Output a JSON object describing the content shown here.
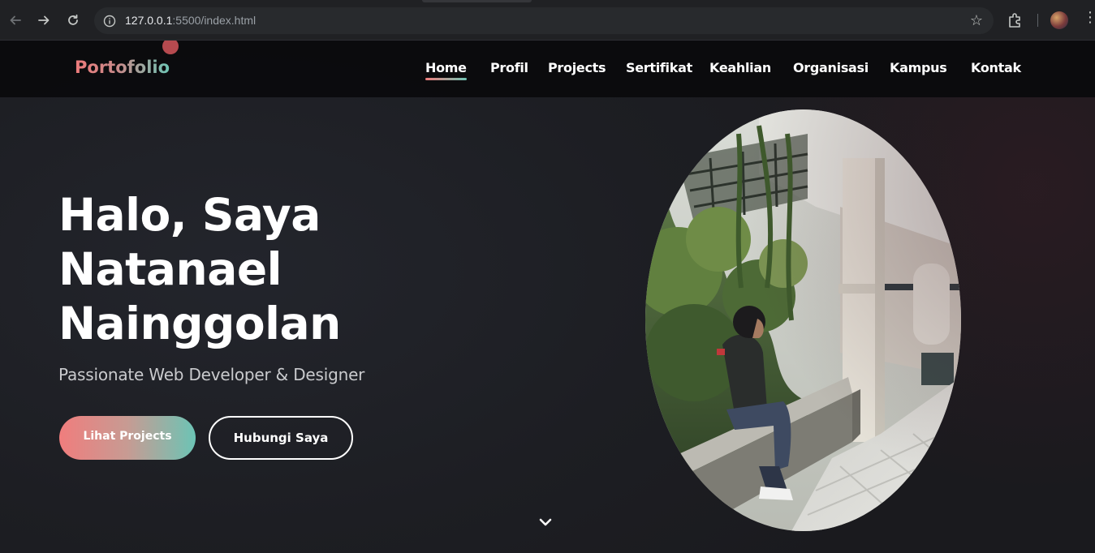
{
  "browser": {
    "url_host": "127.0.0.1",
    "url_path": ":5500/index.html"
  },
  "navbar": {
    "logo": "Portofolio",
    "items": [
      {
        "label": "Home",
        "active": true
      },
      {
        "label": "Profil"
      },
      {
        "label": "Projects"
      },
      {
        "label": "Sertifikat"
      },
      {
        "label": "Keahlian"
      },
      {
        "label": "Organisasi"
      },
      {
        "label": "Kampus"
      },
      {
        "label": "Kontak"
      }
    ]
  },
  "hero": {
    "title_line1": "Halo, Saya",
    "title_line2": "Natanael",
    "title_line3": "Nainggolan",
    "subtitle": "Passionate Web Developer & Designer",
    "primary_button": "Lihat Projects",
    "secondary_button": "Hubungi Saya"
  },
  "colors": {
    "accent_start": "#ee7b7b",
    "accent_end": "#6fc5b5",
    "background": "#1c1d22"
  }
}
